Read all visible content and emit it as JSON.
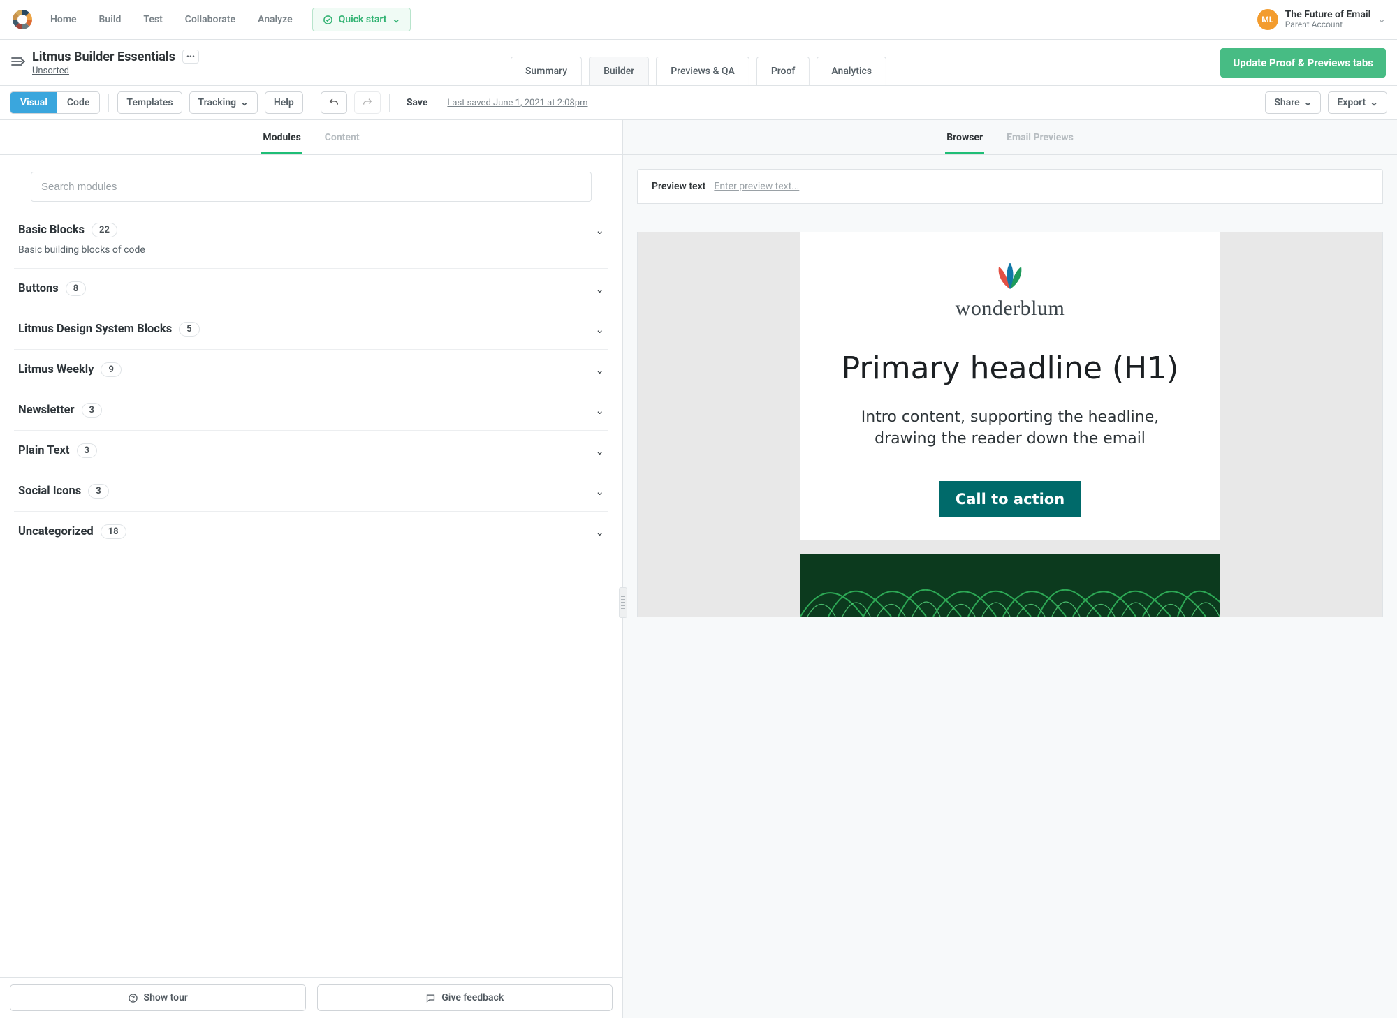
{
  "nav": {
    "links": [
      "Home",
      "Build",
      "Test",
      "Collaborate",
      "Analyze"
    ],
    "quick_start": "Quick start"
  },
  "account": {
    "initials": "ML",
    "name": "The Future of Email",
    "sub": "Parent Account"
  },
  "project": {
    "title": "Litmus Builder Essentials",
    "folder": "Unsorted",
    "tabs": [
      "Summary",
      "Builder",
      "Previews & QA",
      "Proof",
      "Analytics"
    ],
    "active_tab": "Builder",
    "update_btn": "Update Proof & Previews tabs"
  },
  "toolbar": {
    "visual": "Visual",
    "code": "Code",
    "templates": "Templates",
    "tracking": "Tracking",
    "help": "Help",
    "save": "Save",
    "last_saved": "Last saved June 1, 2021 at 2:08pm",
    "share": "Share",
    "export": "Export"
  },
  "left": {
    "tabs": {
      "modules": "Modules",
      "content": "Content"
    },
    "search_placeholder": "Search modules",
    "groups": [
      {
        "name": "Basic Blocks",
        "count": 22,
        "desc": "Basic building blocks of code"
      },
      {
        "name": "Buttons",
        "count": 8
      },
      {
        "name": "Litmus Design System Blocks",
        "count": 5
      },
      {
        "name": "Litmus Weekly",
        "count": 9
      },
      {
        "name": "Newsletter",
        "count": 3
      },
      {
        "name": "Plain Text",
        "count": 3
      },
      {
        "name": "Social Icons",
        "count": 3
      },
      {
        "name": "Uncategorized",
        "count": 18
      }
    ],
    "show_tour": "Show tour",
    "give_feedback": "Give feedback"
  },
  "right": {
    "tabs": {
      "browser": "Browser",
      "previews": "Email Previews"
    },
    "preview_label": "Preview text",
    "preview_hint": "Enter preview text..."
  },
  "email": {
    "brand": "wonderblum",
    "headline": "Primary headline (H1)",
    "intro": "Intro content, supporting the headline, drawing the reader down the email",
    "cta": "Call to action"
  }
}
